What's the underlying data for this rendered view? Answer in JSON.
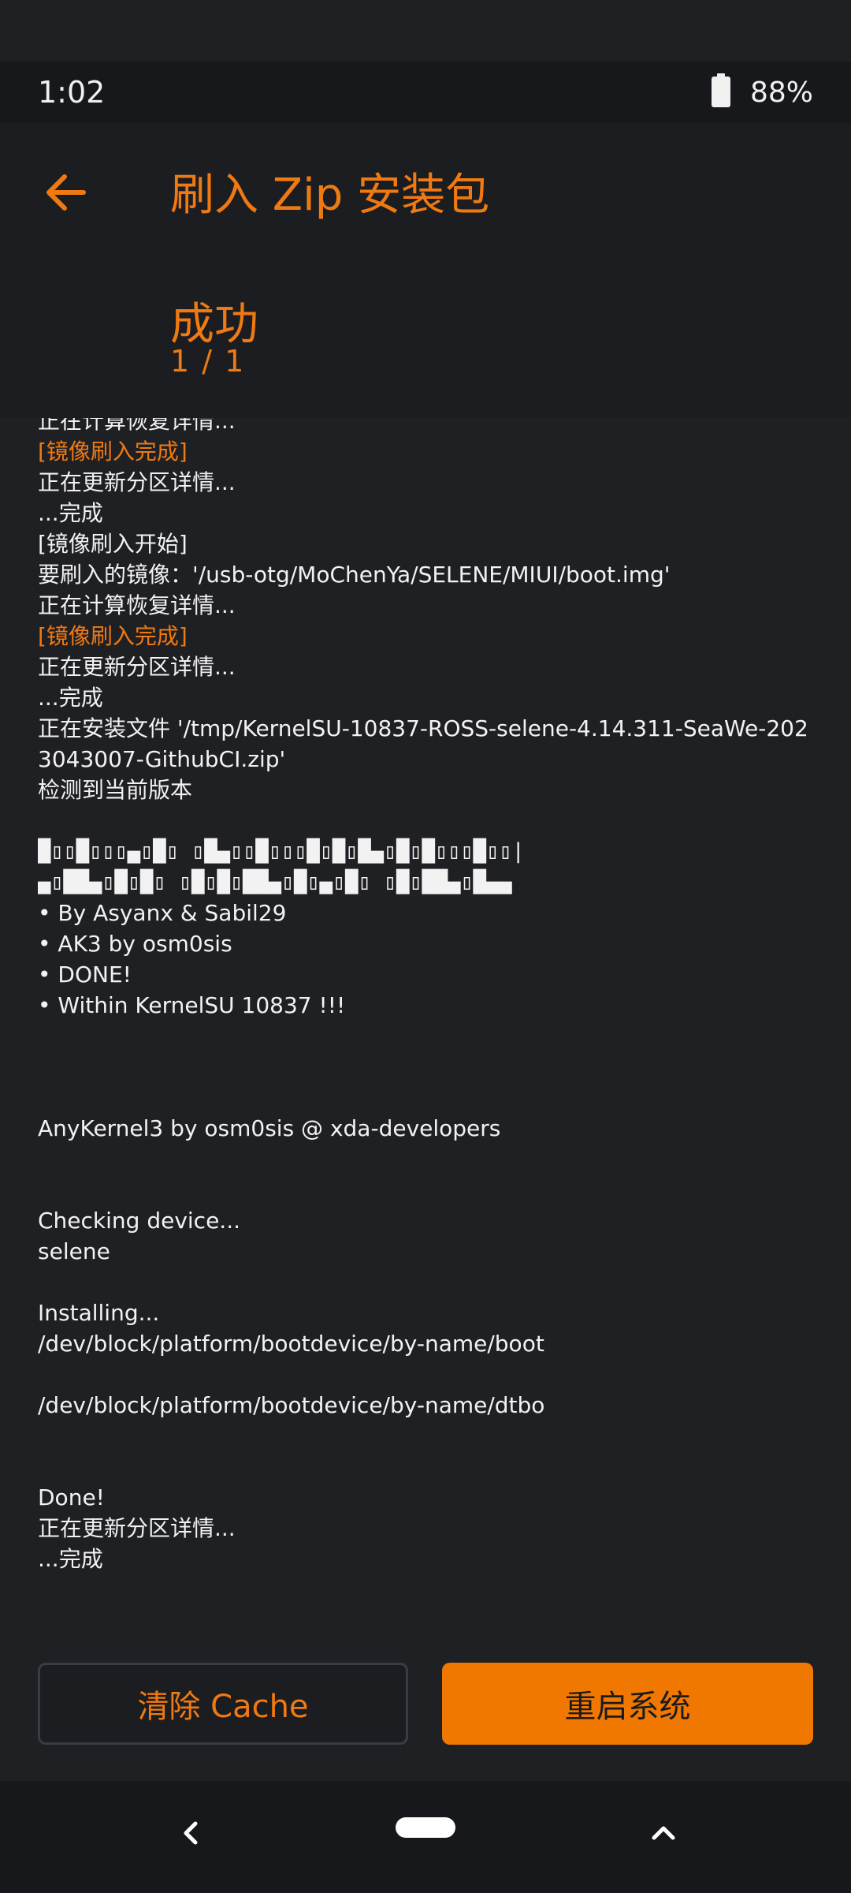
{
  "status_bar": {
    "time": "1:02",
    "battery_percent": "88%"
  },
  "header": {
    "title": "刷入 Zip 安装包",
    "status": "成功",
    "progress": "1 / 1"
  },
  "log": {
    "lines": [
      {
        "text": "正在计算恢复详情...",
        "accent": false
      },
      {
        "text": "[镜像刷入完成]",
        "accent": true
      },
      {
        "text": "正在更新分区详情...",
        "accent": false
      },
      {
        "text": "...完成",
        "accent": false
      },
      {
        "text": "[镜像刷入开始]",
        "accent": false
      },
      {
        "text": "要刷入的镜像：'/usb-otg/MoChenYa/SELENE/MIUI/boot.img'",
        "accent": false
      },
      {
        "text": "正在计算恢复详情...",
        "accent": false
      },
      {
        "text": "[镜像刷入完成]",
        "accent": true
      },
      {
        "text": "正在更新分区详情...",
        "accent": false
      },
      {
        "text": "...完成",
        "accent": false
      },
      {
        "text": "正在安装文件  '/tmp/KernelSU-10837-ROSS-selene-4.14.311-SeaWe-2023043007-GithubCI.zip'",
        "accent": false,
        "wrap": true
      },
      {
        "text": "检测到当前版本",
        "accent": false
      },
      {
        "text": "",
        "accent": false
      },
      {
        "text": "█▯▯█▯▯▯▄▯█▯ ▯█▄▯▯█▯▯▯█▯█▯█▄▯█▯█▯▯▯█▯▯|",
        "accent": false,
        "glyph": true
      },
      {
        "text": "▄▯██▄▯█▯█▯ ▯█▯█▯██▄▯█▯▄▯█▯ ▯█▯██▄▯█▄▄",
        "accent": false,
        "glyph": true
      },
      {
        "text": "• By Asyanx & Sabil29",
        "accent": false
      },
      {
        "text": "• AK3 by osm0sis",
        "accent": false
      },
      {
        "text": "• DONE!",
        "accent": false
      },
      {
        "text": "• Within KernelSU 10837 !!!",
        "accent": false
      },
      {
        "text": "",
        "accent": false
      },
      {
        "text": "",
        "accent": false
      },
      {
        "text": "",
        "accent": false
      },
      {
        "text": "AnyKernel3 by osm0sis @ xda-developers",
        "accent": false
      },
      {
        "text": "",
        "accent": false
      },
      {
        "text": "",
        "accent": false
      },
      {
        "text": "Checking device...",
        "accent": false
      },
      {
        "text": "selene",
        "accent": false
      },
      {
        "text": "",
        "accent": false
      },
      {
        "text": "Installing...",
        "accent": false
      },
      {
        "text": "/dev/block/platform/bootdevice/by-name/boot",
        "accent": false
      },
      {
        "text": "",
        "accent": false
      },
      {
        "text": "/dev/block/platform/bootdevice/by-name/dtbo",
        "accent": false
      },
      {
        "text": "",
        "accent": false
      },
      {
        "text": "",
        "accent": false
      },
      {
        "text": "Done!",
        "accent": false
      },
      {
        "text": "正在更新分区详情...",
        "accent": false
      },
      {
        "text": "...完成",
        "accent": false
      }
    ]
  },
  "buttons": {
    "clear_cache": "清除 Cache",
    "reboot_system": "重启系统"
  },
  "colors": {
    "accent": "#f07a12",
    "background": "#1f2024",
    "primary_button": "#f07800"
  },
  "icons": {
    "back": "arrow-left-icon",
    "battery": "battery-icon",
    "nav_back": "chevron-left-icon",
    "nav_home": "home-pill",
    "nav_recent": "chevron-up-icon"
  }
}
